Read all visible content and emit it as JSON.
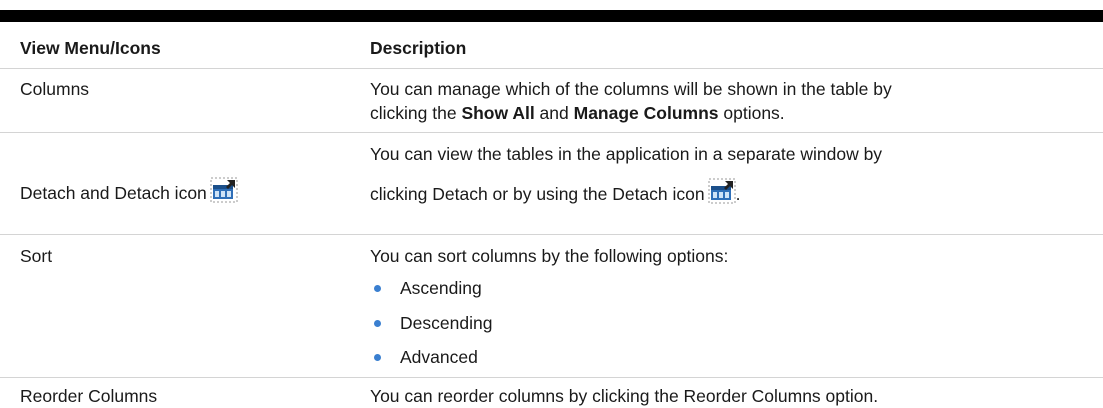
{
  "header": {
    "col1": "View Menu/Icons",
    "col2": "Description"
  },
  "rows": {
    "columns": {
      "label": "Columns",
      "desc_pre": "You can manage which of the columns will be shown in the table by",
      "desc_line2_pre": "clicking the ",
      "bold1": "Show All",
      "and": " and ",
      "bold2": "Manage Columns",
      "desc_post": " options."
    },
    "detach": {
      "label": "Detach and Detach icon",
      "desc_line1": "You can view the tables in the application in a separate window by",
      "desc_line2": "clicking Detach or by using the Detach icon",
      "period": ".",
      "icon": "detach-icon"
    },
    "sort": {
      "label": "Sort",
      "desc": "You can sort columns by the following options:",
      "options": [
        "Ascending",
        "Descending",
        "Advanced"
      ]
    },
    "reorder": {
      "label": "Reorder Columns",
      "desc": "You can reorder columns by clicking the Reorder Columns option."
    }
  },
  "colors": {
    "bullet": "#3a7fd0",
    "rule": "#d4d4d4"
  }
}
